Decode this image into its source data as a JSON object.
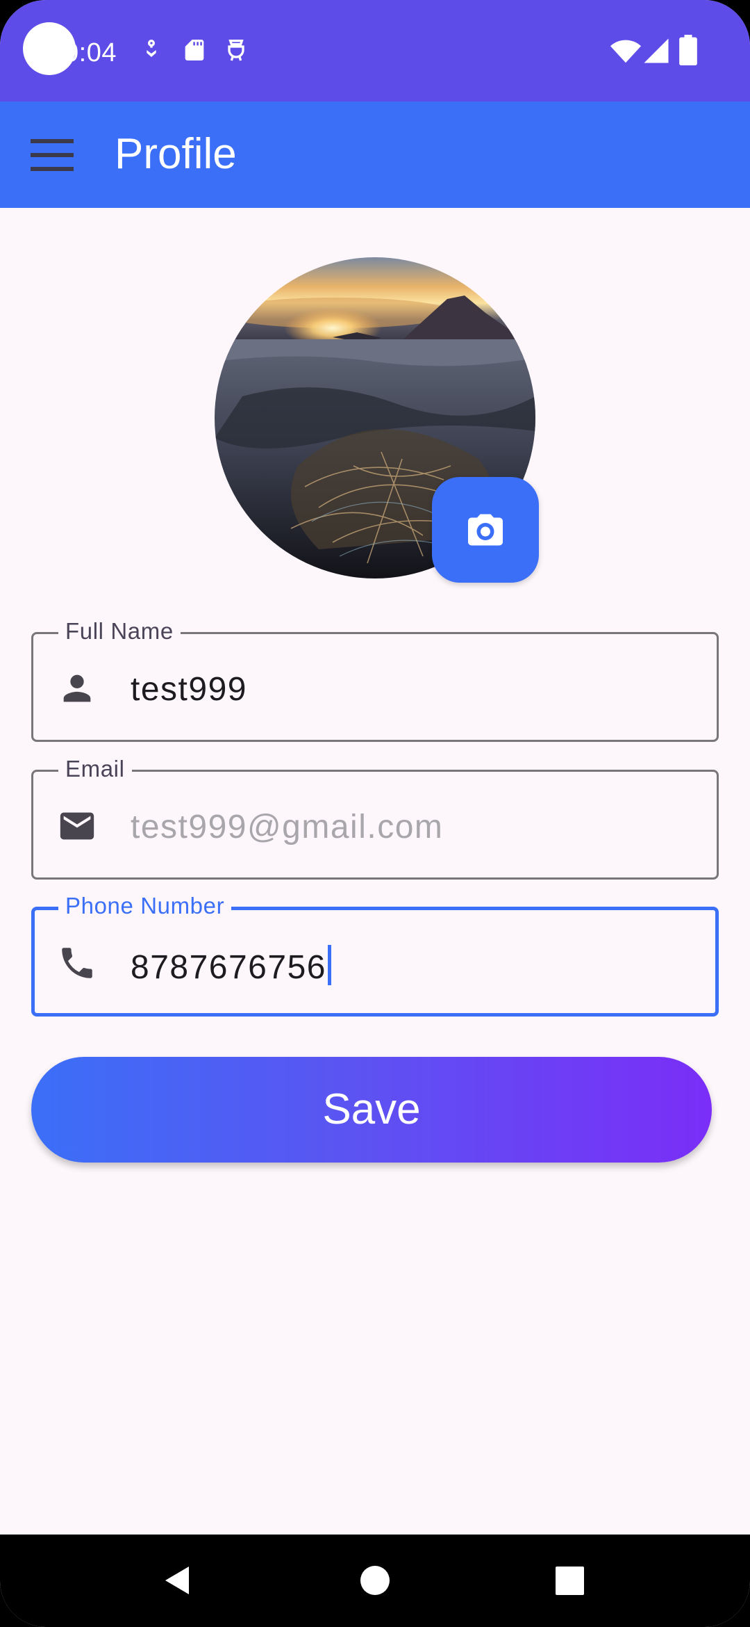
{
  "status_bar": {
    "time": "0:04",
    "icons": [
      "notification-icon",
      "sd-card-icon",
      "lunch-icon",
      "wifi-icon",
      "cellular-signal-icon",
      "battery-icon"
    ]
  },
  "app_bar": {
    "title": "Profile",
    "menu_icon": "menu-icon"
  },
  "profile": {
    "avatar_icon": "profile-photo",
    "camera_icon": "camera-icon"
  },
  "fields": {
    "full_name": {
      "label": "Full Name",
      "value": "test999",
      "icon": "person-icon"
    },
    "email": {
      "label": "Email",
      "value": "test999@gmail.com",
      "icon": "email-icon",
      "enabled": false
    },
    "phone": {
      "label": "Phone Number",
      "value": "8787676756",
      "icon": "phone-icon",
      "focused": true
    }
  },
  "actions": {
    "save_label": "Save"
  },
  "nav_bar": {
    "icons": [
      "back-icon",
      "home-icon",
      "recents-icon"
    ]
  },
  "colors": {
    "status_bar": "#5d4ce8",
    "primary": "#3b6ff8",
    "gradient_end": "#7a2ef7",
    "background": "#fdf7fb"
  }
}
